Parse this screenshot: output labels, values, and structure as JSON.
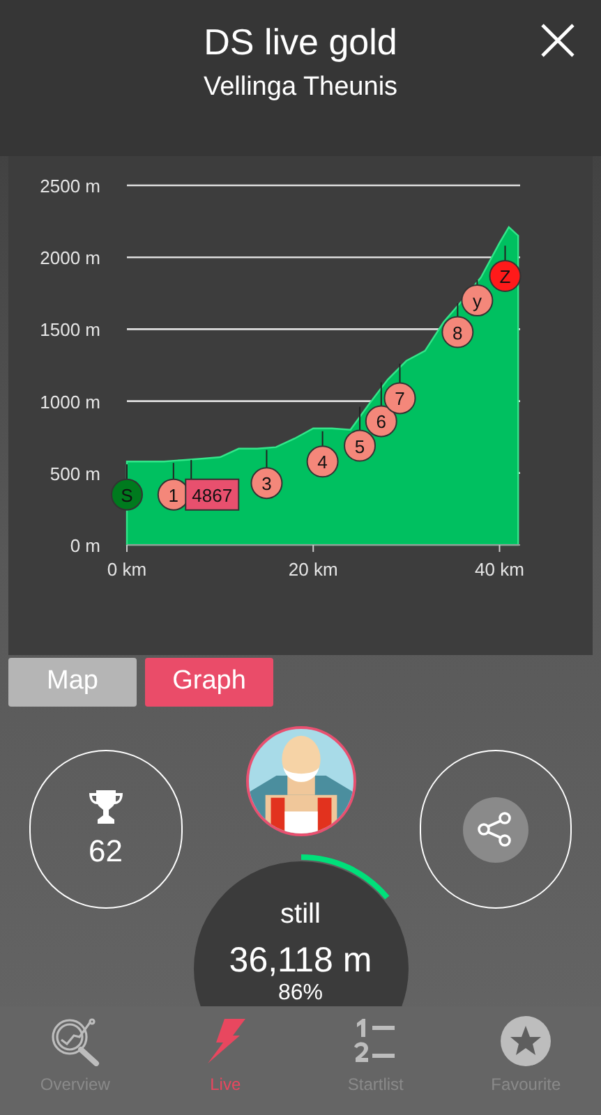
{
  "header": {
    "title": "DS live gold",
    "subtitle": "Vellinga Theunis"
  },
  "graph": {
    "chart_data": {
      "type": "area",
      "grid": true,
      "xlim": [
        0,
        42
      ],
      "ylim": [
        0,
        2500
      ],
      "xticks": [
        {
          "value": 0,
          "label": "0 km"
        },
        {
          "value": 20,
          "label": "20 km"
        },
        {
          "value": 40,
          "label": "40 km"
        }
      ],
      "yticks": [
        {
          "value": 0,
          "label": "0 m"
        },
        {
          "value": 500,
          "label": "500 m"
        },
        {
          "value": 1000,
          "label": "1000 m"
        },
        {
          "value": 1500,
          "label": "1500 m"
        },
        {
          "value": 2000,
          "label": "2000 m"
        },
        {
          "value": 2500,
          "label": "2500 m"
        }
      ],
      "x": [
        0,
        2,
        4,
        6,
        8,
        10,
        12,
        14,
        16,
        18,
        20,
        22,
        24,
        26,
        28,
        30,
        32,
        34,
        36,
        38,
        40,
        41,
        42
      ],
      "series": [
        {
          "color": "#00c060",
          "values": [
            580,
            580,
            580,
            590,
            600,
            610,
            670,
            670,
            680,
            740,
            810,
            810,
            800,
            980,
            1150,
            1280,
            1350,
            1550,
            1700,
            1860,
            2100,
            2210,
            2150
          ]
        }
      ]
    },
    "markers": [
      {
        "kind": "start",
        "label": "S"
      },
      {
        "kind": "point",
        "label": "1"
      },
      {
        "kind": "rider",
        "label": "4867"
      },
      {
        "kind": "point",
        "label": "3"
      },
      {
        "kind": "point",
        "label": "4"
      },
      {
        "kind": "point",
        "label": "5"
      },
      {
        "kind": "point",
        "label": "6"
      },
      {
        "kind": "point",
        "label": "7"
      },
      {
        "kind": "point",
        "label": "8"
      },
      {
        "kind": "point",
        "label": "y"
      },
      {
        "kind": "finish",
        "label": "Z"
      }
    ]
  },
  "view_tabs": [
    {
      "label": "Map",
      "selected": false
    },
    {
      "label": "Graph",
      "selected": true
    }
  ],
  "rank": {
    "value": "62"
  },
  "progress": {
    "label": "still",
    "distance": "36,118 m",
    "percent": "86%"
  },
  "nav": [
    {
      "label": "Overview",
      "kind": "overview",
      "selected": false
    },
    {
      "label": "Live",
      "kind": "live",
      "selected": true
    },
    {
      "label": "Startlist",
      "kind": "startlist",
      "selected": false
    },
    {
      "label": "Favourite",
      "kind": "favourite",
      "selected": false
    }
  ]
}
